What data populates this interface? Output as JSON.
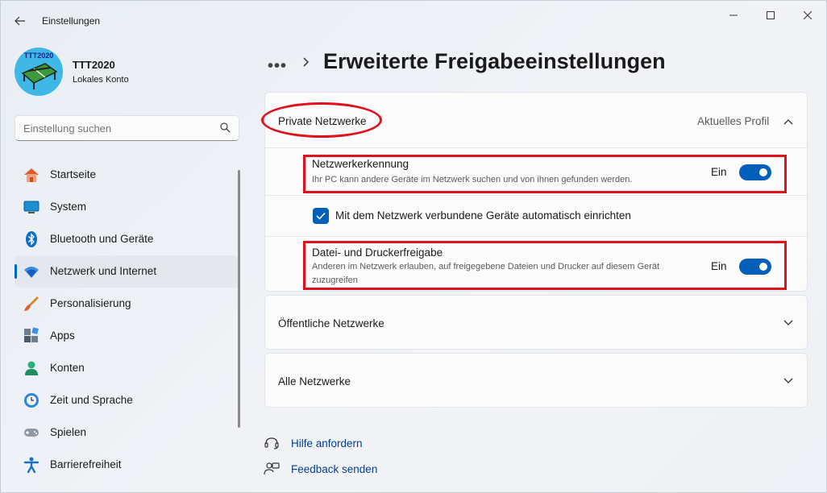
{
  "window": {
    "app_title": "Einstellungen"
  },
  "profile": {
    "avatar_text": "TTT2020",
    "name": "TTT2020",
    "account_type": "Lokales Konto"
  },
  "search": {
    "placeholder": "Einstellung suchen"
  },
  "sidebar": {
    "items": [
      {
        "label": "Startseite",
        "icon": "home-icon"
      },
      {
        "label": "System",
        "icon": "display-icon"
      },
      {
        "label": "Bluetooth und Geräte",
        "icon": "bluetooth-icon"
      },
      {
        "label": "Netzwerk und Internet",
        "icon": "wifi-icon",
        "active": true
      },
      {
        "label": "Personalisierung",
        "icon": "brush-icon"
      },
      {
        "label": "Apps",
        "icon": "apps-icon"
      },
      {
        "label": "Konten",
        "icon": "person-icon"
      },
      {
        "label": "Zeit und Sprache",
        "icon": "clock-globe-icon"
      },
      {
        "label": "Spielen",
        "icon": "gamepad-icon"
      },
      {
        "label": "Barrierefreiheit",
        "icon": "accessibility-icon"
      }
    ]
  },
  "header": {
    "breadcrumb_more": "•••",
    "title": "Erweiterte Freigabeeinstellungen"
  },
  "private_networks": {
    "title": "Private Netzwerke",
    "status": "Aktuelles Profil",
    "expanded": true,
    "network_discovery": {
      "title": "Netzwerkerkennung",
      "description": "Ihr PC kann andere Geräte im Netzwerk suchen und von ihnen gefunden werden.",
      "state_label": "Ein",
      "on": true
    },
    "auto_setup": {
      "label": "Mit dem Netzwerk verbundene Geräte automatisch einrichten",
      "checked": true
    },
    "file_printer_sharing": {
      "title": "Datei- und Druckerfreigabe",
      "description": "Anderen im Netzwerk erlauben, auf freigegebene Dateien und Drucker auf diesem Gerät zuzugreifen",
      "state_label": "Ein",
      "on": true
    }
  },
  "public_networks": {
    "title": "Öffentliche Netzwerke"
  },
  "all_networks": {
    "title": "Alle Netzwerke"
  },
  "footer_links": {
    "help": "Hilfe anfordern",
    "feedback": "Feedback senden"
  },
  "colors": {
    "accent": "#005fb8",
    "highlight": "#e0101c",
    "link": "#003e92"
  }
}
